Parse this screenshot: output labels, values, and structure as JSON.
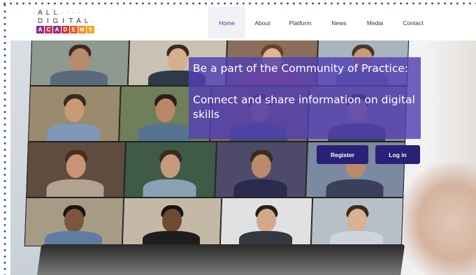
{
  "logo": {
    "row1": [
      "A",
      "L",
      "L"
    ],
    "row2": [
      "D",
      "I",
      "G",
      "I",
      "T",
      "A",
      "L"
    ],
    "row3": [
      {
        "letter": "A",
        "color": "#8b2b8f"
      },
      {
        "letter": "C",
        "color": "#c4306a"
      },
      {
        "letter": "A",
        "color": "#8e2f8a"
      },
      {
        "letter": "D",
        "color": "#d8312e"
      },
      {
        "letter": "E",
        "color": "#e25a2b"
      },
      {
        "letter": "M",
        "color": "#ef8a1f"
      },
      {
        "letter": "Y",
        "color": "#f4a71c"
      }
    ]
  },
  "nav": {
    "items": [
      {
        "label": "Home",
        "active": true
      },
      {
        "label": "About",
        "active": false
      },
      {
        "label": "Platform",
        "active": false
      },
      {
        "label": "News",
        "active": false
      },
      {
        "label": "Media",
        "active": false
      },
      {
        "label": "Contact",
        "active": false
      }
    ]
  },
  "hero": {
    "headline_line1": "Be a part of the Community of Practice:",
    "headline_line2": "Connect and share information on digital skills",
    "register_label": "Register",
    "login_label": "Log in"
  },
  "colors": {
    "accent": "#2a2176",
    "overlay": "#533fb2",
    "frame_dots": "#3b3a8c"
  }
}
